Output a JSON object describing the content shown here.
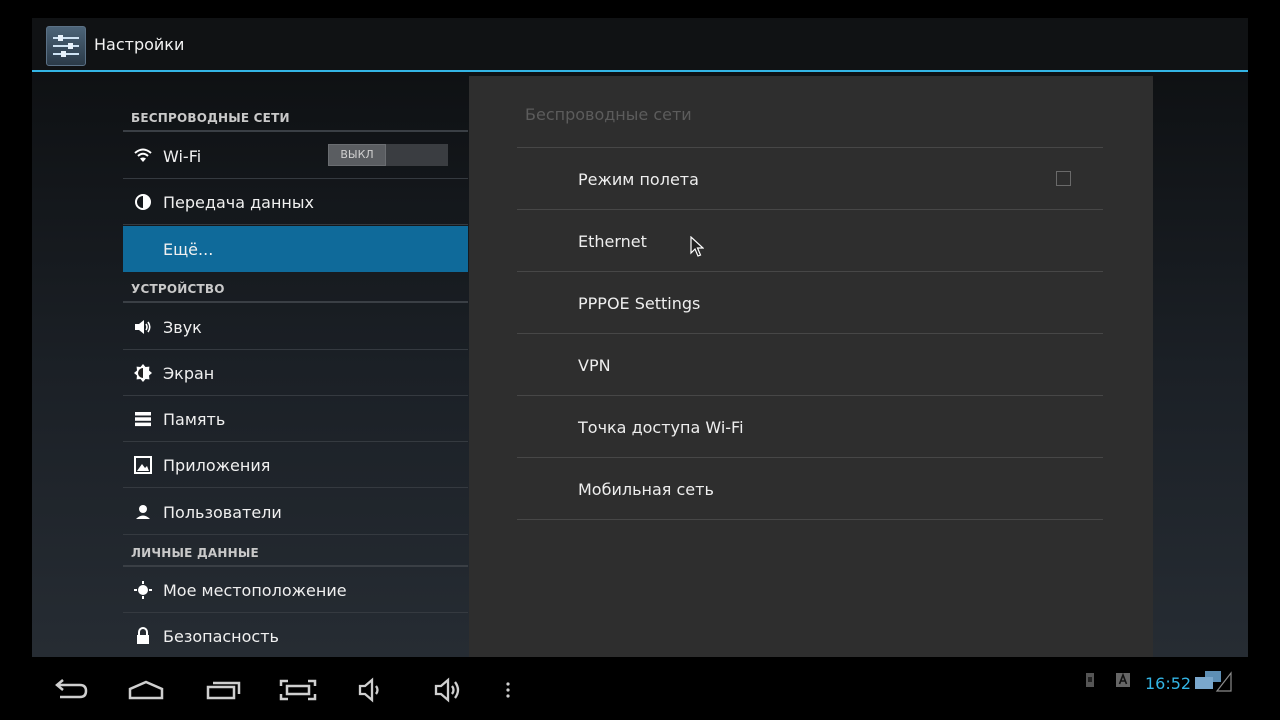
{
  "app": {
    "title": "Настройки",
    "icon": "settings-sliders-icon"
  },
  "sidebar": {
    "sections": [
      {
        "header": "БЕСПРОВОДНЫЕ СЕТИ",
        "items": [
          {
            "label": "Wi-Fi",
            "icon": "wifi-icon",
            "toggle": "ВЫКЛ"
          },
          {
            "label": "Передача данных",
            "icon": "data-usage-icon"
          },
          {
            "label": "Ещё...",
            "icon": "none",
            "selected": true
          }
        ]
      },
      {
        "header": "УСТРОЙСТВО",
        "items": [
          {
            "label": "Звук",
            "icon": "speaker-icon"
          },
          {
            "label": "Экран",
            "icon": "brightness-icon"
          },
          {
            "label": "Память",
            "icon": "storage-icon"
          },
          {
            "label": "Приложения",
            "icon": "apps-icon"
          },
          {
            "label": "Пользователи",
            "icon": "user-icon"
          }
        ]
      },
      {
        "header": "ЛИЧНЫЕ ДАННЫЕ",
        "items": [
          {
            "label": "Мое местоположение",
            "icon": "location-icon"
          },
          {
            "label": "Безопасность",
            "icon": "lock-icon"
          }
        ]
      }
    ]
  },
  "detail": {
    "title": "Беспроводные сети",
    "items": [
      {
        "label": "Режим полета",
        "checkbox": false
      },
      {
        "label": "Ethernet"
      },
      {
        "label": "PPPOE Settings"
      },
      {
        "label": "VPN"
      },
      {
        "label": "Точка доступа Wi-Fi"
      },
      {
        "label": "Мобильная сеть"
      }
    ]
  },
  "navbar": {
    "buttons": [
      "back-icon",
      "home-icon",
      "recent-apps-icon",
      "screenshot-icon",
      "volume-down-icon",
      "volume-up-icon",
      "menu-icon"
    ],
    "status": {
      "time": "16:52",
      "icons": [
        "sd-card-icon",
        "keyboard-icon",
        "network-icon"
      ]
    }
  },
  "colors": {
    "accent": "#33b5e5",
    "selected": "#0f6a9a",
    "detail_bg": "#2e2e2e"
  }
}
